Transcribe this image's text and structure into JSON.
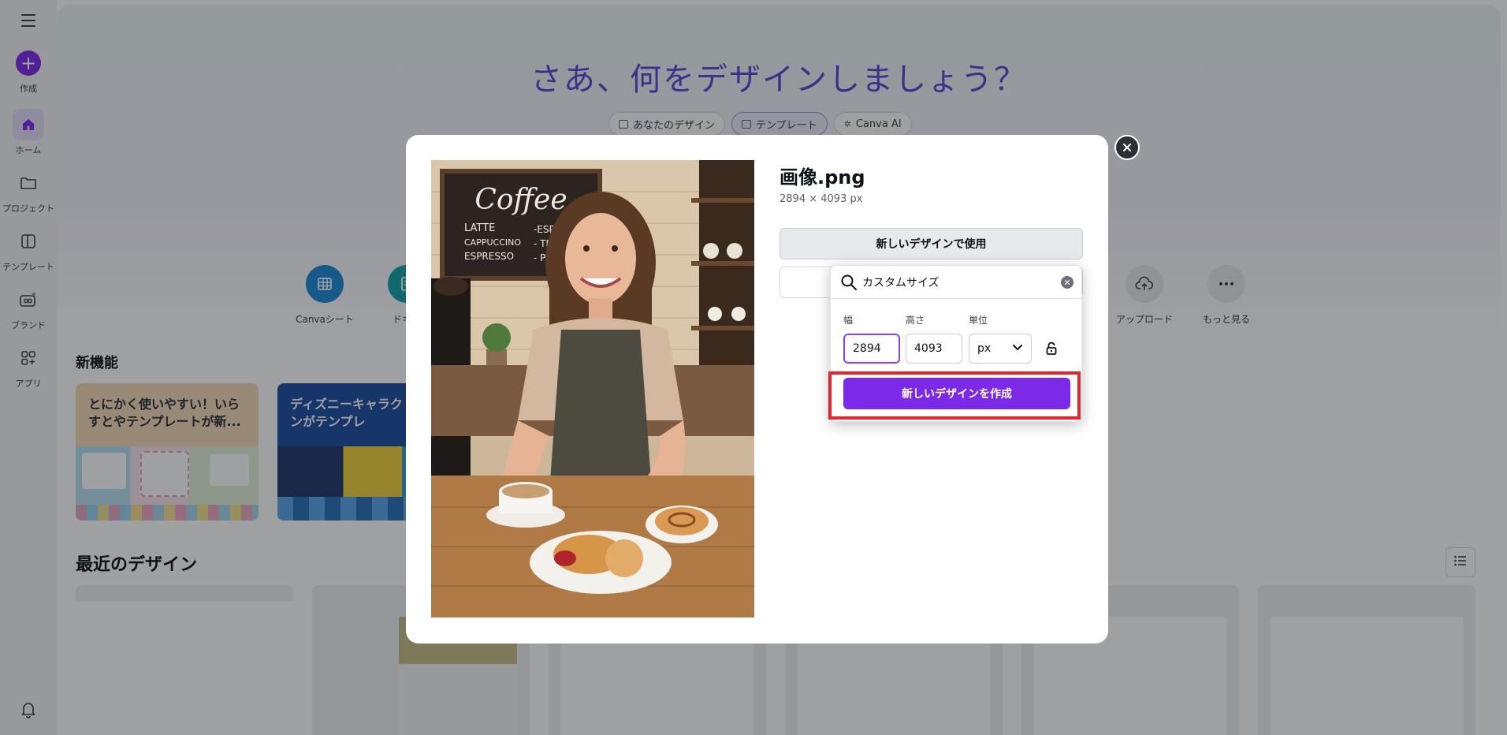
{
  "sidebar": {
    "items": [
      {
        "label": "作成",
        "icon": "plus-icon"
      },
      {
        "label": "ホーム",
        "icon": "home-icon"
      },
      {
        "label": "プロジェクト",
        "icon": "folder-icon"
      },
      {
        "label": "テンプレート",
        "icon": "template-icon"
      },
      {
        "label": "ブランド",
        "icon": "brand-icon"
      },
      {
        "label": "アプリ",
        "icon": "apps-icon"
      }
    ]
  },
  "hero": {
    "title": "さあ、何をデザインしましょう？",
    "tabs": [
      {
        "label": "あなたのデザイン",
        "icon": "folder-icon"
      },
      {
        "label": "テンプレート",
        "icon": "template-icon"
      },
      {
        "label": "Canva AI",
        "icon": "sparkle-icon"
      }
    ]
  },
  "shortcuts": [
    {
      "label": "Canvaシート",
      "icon": "sheet-icon"
    },
    {
      "label": "ドキュ",
      "icon": "doc-icon"
    },
    {
      "label": "アップロード",
      "icon": "upload-icon"
    },
    {
      "label": "もっと見る",
      "icon": "more-icon"
    }
  ],
  "features": {
    "title": "新機能",
    "cards": [
      {
        "caption": "とにかく使いやすい！いらすとやテンプレートが新..."
      },
      {
        "caption": "ディズニーキャラク デザインがテンプレ"
      }
    ]
  },
  "recent": {
    "title": "最近のデザイン"
  },
  "modal": {
    "file_name": "画像.png",
    "dimensions": "2894 × 4093 px",
    "use_button": "新しいデザインで使用",
    "close_icon": "close-icon"
  },
  "dropdown": {
    "search_value": "カスタムサイズ",
    "width_label": "幅",
    "height_label": "高さ",
    "unit_label": "単位",
    "width_value": "2894",
    "height_value": "4093",
    "unit_value": "px",
    "create_button": "新しいデザインを作成"
  },
  "colors": {
    "accent": "#7d2ae8",
    "hero_title": "#5a49d6",
    "highlight": "#e4252d"
  }
}
